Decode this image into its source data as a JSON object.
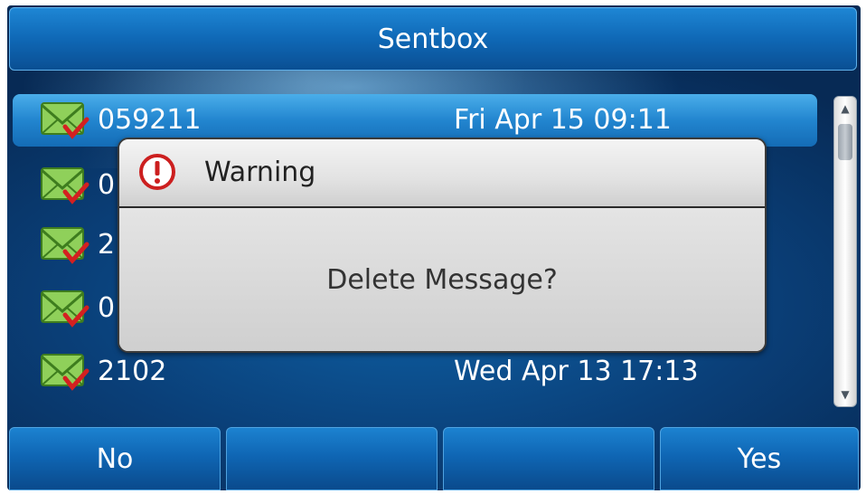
{
  "header": {
    "title": "Sentbox"
  },
  "messages": [
    {
      "number": "059211",
      "date": "Fri Apr 15 09:11",
      "icon": "sent-mail-icon"
    },
    {
      "number": "0",
      "date": "",
      "icon": "sent-mail-icon"
    },
    {
      "number": "2",
      "date": "",
      "icon": "sent-mail-icon"
    },
    {
      "number": "0",
      "date": "",
      "icon": "sent-mail-icon"
    },
    {
      "number": "2102",
      "date": "Wed Apr 13 17:13",
      "icon": "sent-mail-icon"
    }
  ],
  "dialog": {
    "title": "Warning",
    "message": "Delete Message?",
    "icon": "warning-icon"
  },
  "softkeys": {
    "key1": "No",
    "key2": "",
    "key3": "",
    "key4": "Yes"
  },
  "colors": {
    "background": "#0a3f78",
    "accent": "#1e86d4",
    "selected_row": "#2285cf",
    "warning_red": "#cc1f1f",
    "envelope_green": "#7fc24a",
    "check_red": "#d42020"
  }
}
